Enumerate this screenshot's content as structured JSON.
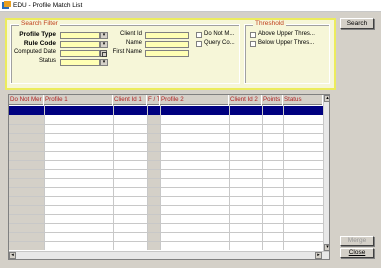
{
  "window": {
    "title": "EDU - Profile Match List"
  },
  "search_filter": {
    "legend": "Search Filter",
    "profile_type_label": "Profile Type",
    "rule_code_label": "Rule Code",
    "computed_date_label": "Computed Date",
    "status_label": "Status",
    "client_id_label": "Client Id",
    "name_label": "Name",
    "first_name_label": "First Name",
    "do_not_match_label": "Do Not M...",
    "query_co_label": "Query Co..."
  },
  "threshold": {
    "legend": "Threshold",
    "above_label": "Above Upper Thres...",
    "below_label": "Below Upper Thres..."
  },
  "buttons": {
    "search": "Search",
    "merge": "Merge",
    "close": "Close"
  },
  "grid": {
    "columns": [
      "Do Not Mer",
      "Profile 1",
      "Client Id 1",
      "F / T",
      "Profile 2",
      "Client Id 2",
      "Points",
      "Status"
    ]
  }
}
